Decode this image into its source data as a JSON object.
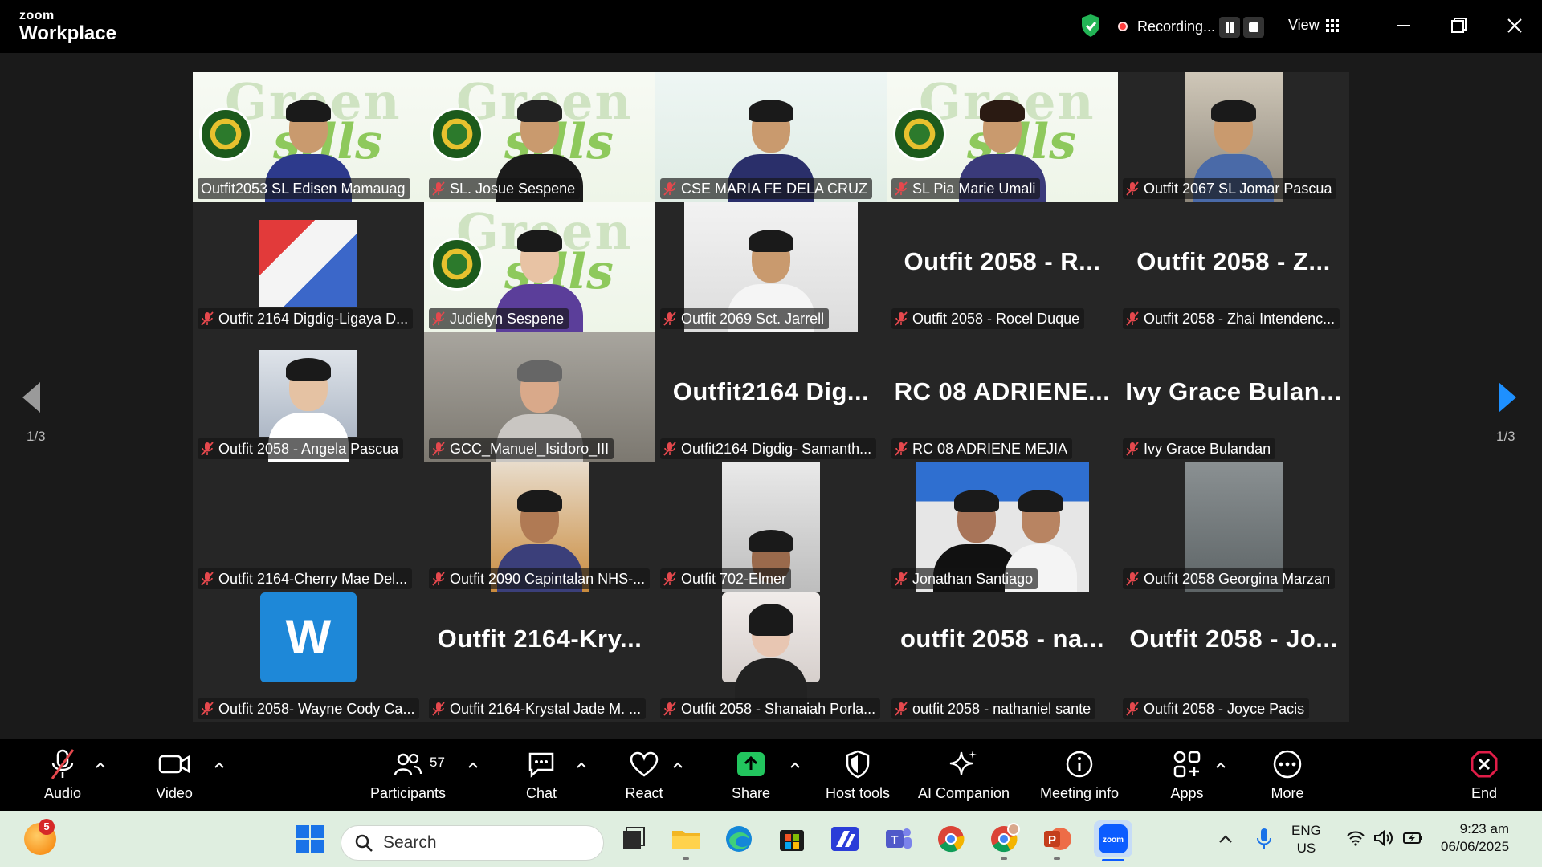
{
  "app": {
    "brand_small": "zoom",
    "brand_large": "Workplace"
  },
  "recording": {
    "label": "Recording..."
  },
  "view": {
    "label": "View"
  },
  "gallery": {
    "page_left": "1/3",
    "page_right": "1/3",
    "tiles": [
      "Outfit2053 SL Edisen Mamauag",
      "SL. Josue Sespene",
      "CSE MARIA FE DELA CRUZ",
      "SL Pia Marie Umali",
      "Outfit 2067 SL Jomar Pascua",
      "Outfit 2164 Digdig-Ligaya D...",
      "Judielyn Sespene",
      "Outfit 2069 Sct. Jarrell",
      "Outfit 2058 - Rocel Duque",
      "Outfit 2058 - Zhai Intendenc...",
      "Outfit 2058 - Angela Pascua",
      "GCC_Manuel_Isidoro_III",
      "Outfit2164 Digdig- Samanth...",
      "RC 08 ADRIENE MEJIA",
      "Ivy Grace Bulandan",
      "Outfit 2164-Cherry Mae Del...",
      "Outfit 2090 Capintalan NHS-...",
      "Outfit 702-Elmer",
      "Jonathan Santiago",
      "Outfit 2058 Georgina Marzan",
      "Outfit 2058- Wayne Cody Ca...",
      "Outfit 2164-Krystal Jade M. ...",
      "Outfit 2058 - Shanaiah Porla...",
      "outfit 2058 - nathaniel sante",
      "Outfit 2058 - Joyce Pacis"
    ],
    "big_names": {
      "t8": "Outfit 2058 - R...",
      "t9": "Outfit 2058 - Z...",
      "t12": "Outfit2164 Dig...",
      "t13": "RC 08 ADRIENE...",
      "t14": "Ivy Grace Bulan...",
      "t21": "Outfit 2164-Kry...",
      "t23": "outfit 2058 - na...",
      "t24": "Outfit 2058 - Jo..."
    },
    "wayne_letter": "W",
    "bg_word_a": "Green",
    "bg_word_b": "sills"
  },
  "toolbar": {
    "audio": "Audio",
    "video": "Video",
    "participants": "Participants",
    "participants_count": "57",
    "chat": "Chat",
    "react": "React",
    "share": "Share",
    "host_tools": "Host tools",
    "ai_companion": "AI Companion",
    "meeting_info": "Meeting info",
    "apps": "Apps",
    "more": "More",
    "end": "End"
  },
  "taskbar": {
    "search_placeholder": "Search",
    "notification_count": "5",
    "lang_top": "ENG",
    "lang_bottom": "US",
    "time": "9:23 am",
    "date": "06/06/2025"
  },
  "colors": {
    "active_speaker": "#2ee6a0",
    "share_green": "#22c55e",
    "end_red": "#e11d48"
  }
}
